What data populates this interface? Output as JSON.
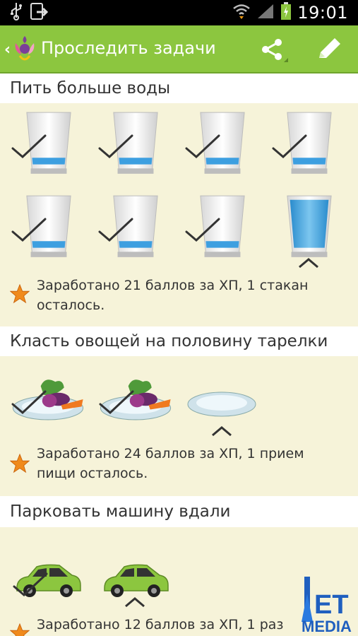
{
  "status_bar": {
    "time": "19:01",
    "icons": [
      "usb-icon",
      "sync-icon",
      "wifi-icon",
      "signal-icon",
      "battery-charging-icon"
    ]
  },
  "action_bar": {
    "title": "Проследить задачи",
    "actions": [
      "share-icon",
      "edit-icon"
    ],
    "color": "#8cc63f"
  },
  "sections": [
    {
      "title": "Пить больше воды",
      "items_total": 8,
      "items_done": 7,
      "reward_text": "Заработано 21 баллов за ХП, 1 стакан осталось."
    },
    {
      "title": "Класть овощей на половину тарелки",
      "items_total": 3,
      "items_done": 2,
      "reward_text": "Заработано 24 баллов за ХП, 1 прием пищи осталось."
    },
    {
      "title": "Парковать машину вдали",
      "items_total": 2,
      "items_done": 1,
      "reward_text": "Заработано 12 баллов за ХП, 1 раз"
    }
  ],
  "watermark": {
    "text_top": "ЕТ",
    "text_bottom": "MEDIA"
  }
}
